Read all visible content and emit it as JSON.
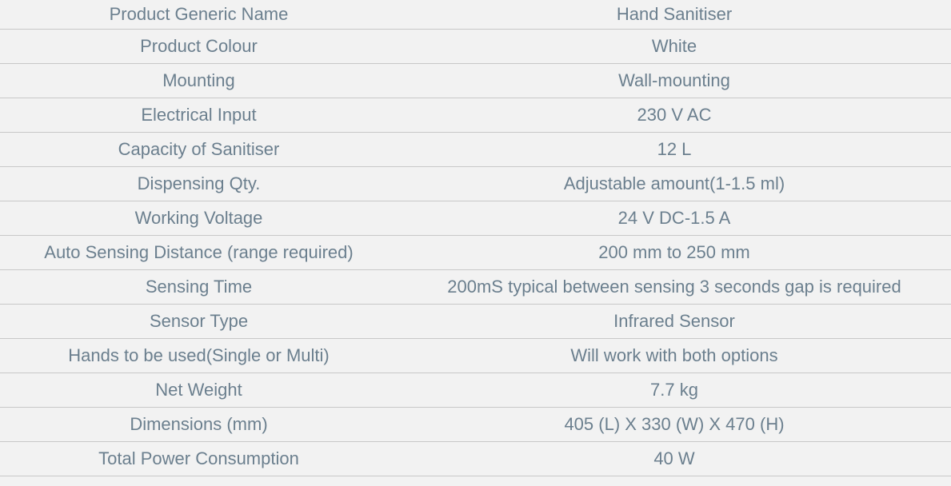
{
  "specs": [
    {
      "label": "Product Generic Name",
      "value": "Hand Sanitiser"
    },
    {
      "label": "Product Colour",
      "value": "White"
    },
    {
      "label": "Mounting",
      "value": "Wall-mounting"
    },
    {
      "label": "Electrical Input",
      "value": "230 V AC"
    },
    {
      "label": "Capacity of Sanitiser",
      "value": "12 L"
    },
    {
      "label": "Dispensing Qty.",
      "value": "Adjustable amount(1-1.5 ml)"
    },
    {
      "label": "Working Voltage",
      "value": "24 V DC-1.5 A"
    },
    {
      "label": "Auto Sensing Distance (range required)",
      "value": "200 mm to 250 mm"
    },
    {
      "label": "Sensing Time",
      "value": "200mS typical between sensing 3 seconds gap is required"
    },
    {
      "label": "Sensor Type",
      "value": "Infrared Sensor"
    },
    {
      "label": "Hands to be used(Single or Multi)",
      "value": "Will work with both options"
    },
    {
      "label": "Net Weight",
      "value": "7.7 kg"
    },
    {
      "label": "Dimensions (mm)",
      "value": "405 (L) X 330 (W) X 470 (H)"
    },
    {
      "label": "Total Power Consumption",
      "value": "40 W"
    }
  ]
}
